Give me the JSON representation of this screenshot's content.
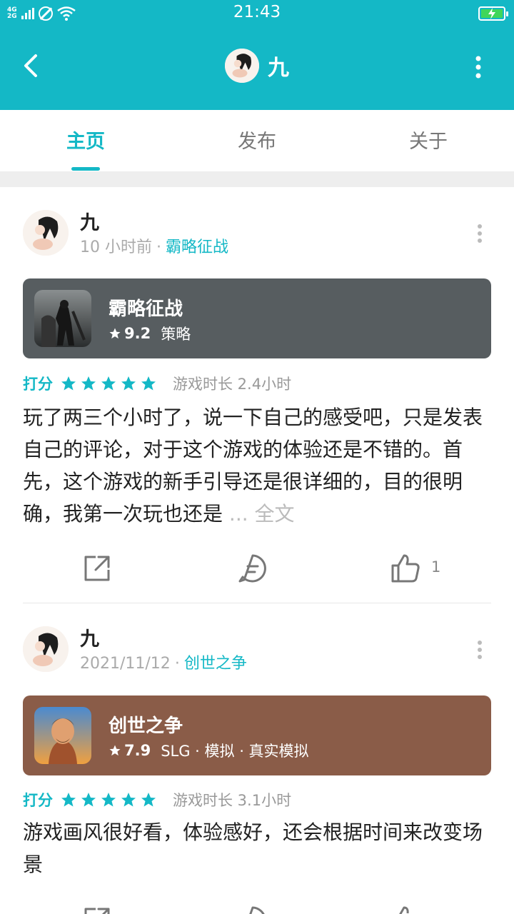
{
  "status_bar": {
    "time": "21:43",
    "network_top": "4G",
    "network_bottom": "2G"
  },
  "header": {
    "title": "九",
    "back_icon": "back-arrow-icon",
    "more_icon": "more-vertical-icon"
  },
  "tabs": [
    {
      "label": "主页",
      "active": true
    },
    {
      "label": "发布",
      "active": false
    },
    {
      "label": "关于",
      "active": false
    }
  ],
  "colors": {
    "accent": "#14b8c6",
    "card_1": "#575d60",
    "card_2": "#8a5c48"
  },
  "posts": [
    {
      "author": "九",
      "time": "10 小时前",
      "separator": "·",
      "game_link": "霸略征战",
      "game": {
        "name": "霸略征战",
        "score": "9.2",
        "tags": "策略"
      },
      "rating_label": "打分",
      "stars": 5,
      "play_time": "游戏时长 2.4小时",
      "text": "玩了两三个小时了，说一下自己的感受吧，只是发表自己的评论，对于这个游戏的体验还是不错的。首先，这个游戏的新手引导还是很详细的，目的很明确，我第一次玩也还是",
      "more": "... 全文",
      "likes": "1"
    },
    {
      "author": "九",
      "time": "2021/11/12",
      "separator": "·",
      "game_link": "创世之争",
      "game": {
        "name": "创世之争",
        "score": "7.9",
        "tags": "SLG · 模拟 · 真实模拟"
      },
      "rating_label": "打分",
      "stars": 5,
      "play_time": "游戏时长 3.1小时",
      "text": "游戏画风很好看，体验感好，还会根据时间来改变场景"
    }
  ]
}
